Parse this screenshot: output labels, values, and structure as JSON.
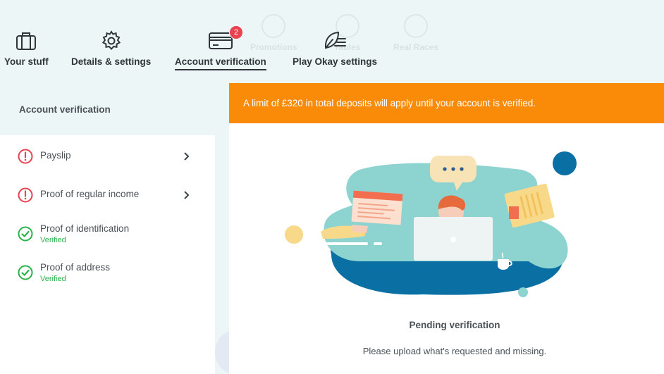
{
  "nav": {
    "items": [
      {
        "label": "Your stuff",
        "icon": "briefcase-icon"
      },
      {
        "label": "Details & settings",
        "icon": "gear-icon"
      },
      {
        "label": "Account verification",
        "icon": "credit-card-icon",
        "badge": "2",
        "active": true
      },
      {
        "label": "Play Okay settings",
        "icon": "leaf-icon"
      }
    ],
    "ghost_items": [
      "Promotions",
      "Tables",
      "Real Races"
    ]
  },
  "sidebar": {
    "title": "Account verification",
    "items": [
      {
        "title": "Payslip",
        "status": "missing"
      },
      {
        "title": "Proof of regular income",
        "status": "missing"
      },
      {
        "title": "Proof of identification",
        "status": "verified",
        "subtitle": "Verified"
      },
      {
        "title": "Proof of address",
        "status": "verified",
        "subtitle": "Verified"
      }
    ]
  },
  "main": {
    "alert": "A limit of £320 in total deposits will apply until your account is verified.",
    "pending_title": "Pending verification",
    "pending_subtitle": "Please upload what's requested and missing."
  },
  "colors": {
    "alert_bg": "#f98b09",
    "badge": "#e94352",
    "missing": "#e94352",
    "verified": "#2bb24c",
    "teal": "#8dd3cf",
    "navy": "#0a6fa3"
  }
}
